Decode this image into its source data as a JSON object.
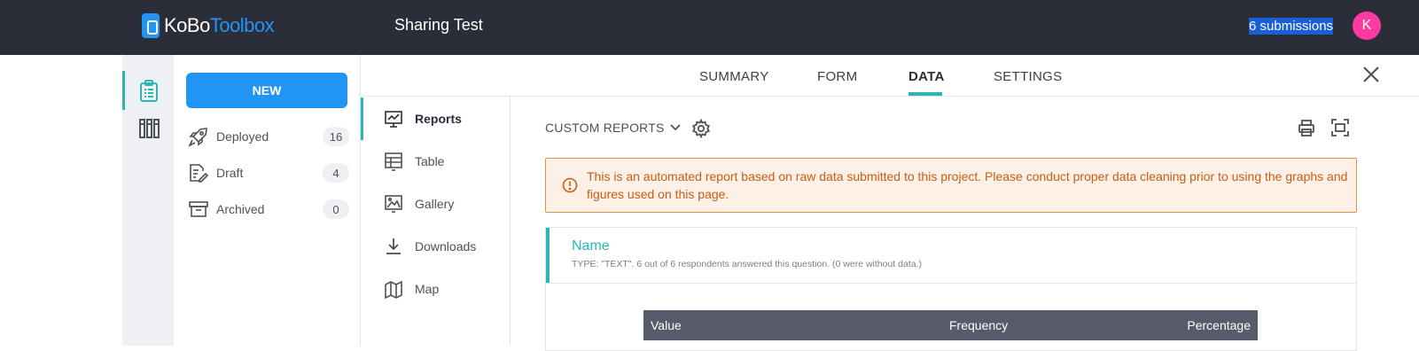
{
  "app": {
    "logo_part1": "KoBo",
    "logo_part2": "Toolbox",
    "project_title": "Sharing Test",
    "submissions": "6 submissions",
    "avatar_initial": "K",
    "accent": "#2bb6b5",
    "brand_blue": "#2095f3"
  },
  "sidebar": {
    "new_label": "NEW",
    "items": [
      {
        "label": "Deployed",
        "count": "16",
        "icon": "rocket-icon"
      },
      {
        "label": "Draft",
        "count": "4",
        "icon": "draft-icon"
      },
      {
        "label": "Archived",
        "count": "0",
        "icon": "archive-icon"
      }
    ]
  },
  "tabs": [
    {
      "label": "SUMMARY",
      "active": false
    },
    {
      "label": "FORM",
      "active": false
    },
    {
      "label": "DATA",
      "active": true
    },
    {
      "label": "SETTINGS",
      "active": false
    }
  ],
  "data_menu": [
    {
      "label": "Reports",
      "icon": "reports-icon",
      "active": true
    },
    {
      "label": "Table",
      "icon": "table-icon",
      "active": false
    },
    {
      "label": "Gallery",
      "icon": "gallery-icon",
      "active": false
    },
    {
      "label": "Downloads",
      "icon": "download-icon",
      "active": false
    },
    {
      "label": "Map",
      "icon": "map-icon",
      "active": false
    }
  ],
  "report": {
    "custom_reports_label": "CUSTOM REPORTS",
    "alert_text": "This is an automated report based on raw data submitted to this project. Please conduct proper data cleaning prior to using the graphs and figures used on this page.",
    "question": {
      "name": "Name",
      "meta": "TYPE: \"TEXT\". 6 out of 6 respondents answered this question. (0 were without data.)"
    },
    "table_headers": {
      "value": "Value",
      "frequency": "Frequency",
      "percentage": "Percentage"
    }
  }
}
